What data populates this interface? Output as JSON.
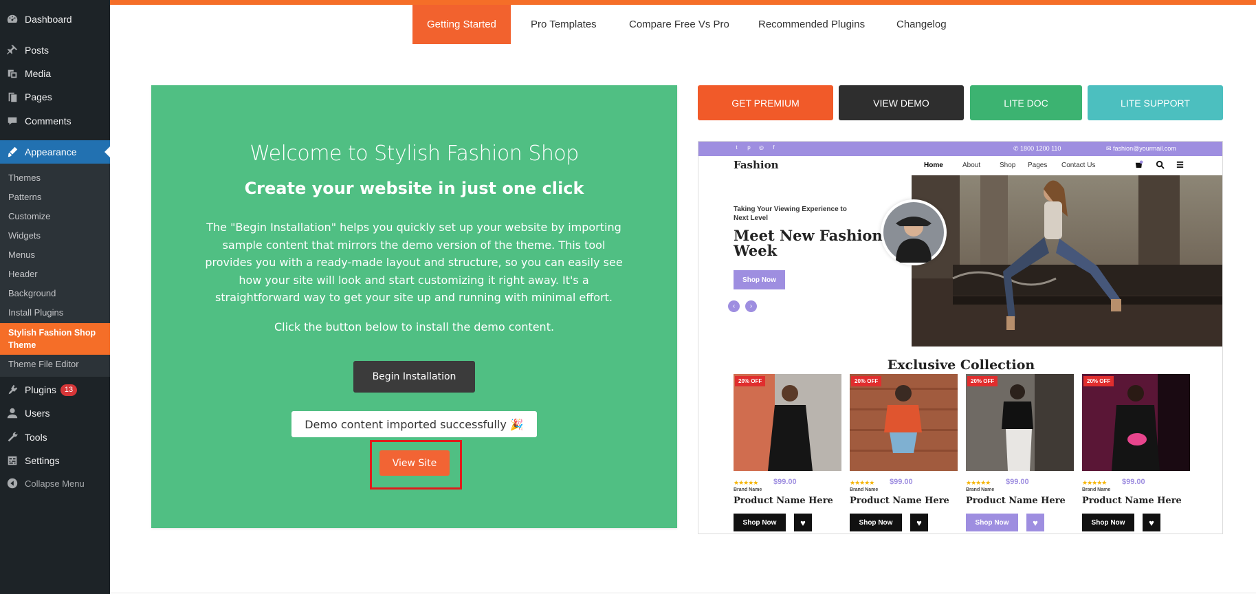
{
  "sidebar": {
    "items": [
      {
        "label": "Dashboard",
        "icon": "dashboard-icon"
      },
      {
        "label": "Posts",
        "icon": "pin-icon"
      },
      {
        "label": "Media",
        "icon": "media-icon"
      },
      {
        "label": "Pages",
        "icon": "pages-icon"
      },
      {
        "label": "Comments",
        "icon": "comment-icon"
      },
      {
        "label": "Appearance",
        "icon": "brush-icon"
      }
    ],
    "appearance_sub": [
      "Themes",
      "Patterns",
      "Customize",
      "Widgets",
      "Menus",
      "Header",
      "Background",
      "Install Plugins"
    ],
    "current_sub": "Stylish Fashion Shop Theme",
    "theme_file_editor": "Theme File Editor",
    "lower_items": [
      {
        "label": "Plugins",
        "icon": "plugin-icon",
        "badge": "13"
      },
      {
        "label": "Users",
        "icon": "users-icon"
      },
      {
        "label": "Tools",
        "icon": "wrench-icon"
      },
      {
        "label": "Settings",
        "icon": "settings-icon"
      }
    ],
    "collapse": "Collapse Menu"
  },
  "tabs": [
    "Getting Started",
    "Pro Templates",
    "Compare Free Vs Pro",
    "Recommended Plugins",
    "Changelog"
  ],
  "welcome": {
    "title": "Welcome to Stylish Fashion Shop",
    "subtitle": "Create your website in just one click",
    "description": "The \"Begin Installation\" helps you quickly set up your website by importing sample content that mirrors the demo version of the theme. This tool provides you with a ready-made layout and structure, so you can easily see how your site will look and start customizing it right away. It's a straightforward way to get your site up and running with minimal effort.",
    "click_text": "Click the button below to install the demo content.",
    "begin_button": "Begin Installation",
    "success_message": "Demo content imported successfully 🎉",
    "view_site_button": "View Site"
  },
  "actions": [
    {
      "label": "GET PREMIUM",
      "color": "#f15a29"
    },
    {
      "label": "VIEW DEMO",
      "color": "#2e2e2e"
    },
    {
      "label": "LITE DOC",
      "color": "#3cb371"
    },
    {
      "label": "LITE SUPPORT",
      "color": "#4cbfbf"
    }
  ],
  "preview": {
    "phone": "1800 1200 110",
    "email": "fashion@yourmail.com",
    "logo": "Fashion",
    "nav": [
      "Home",
      "About",
      "Shop",
      "Pages",
      "Contact Us"
    ],
    "hero_tagline": "Taking Your Viewing Experience to Next Level",
    "hero_title": "Meet New Fashion Week",
    "hero_button": "Shop Now",
    "section_title": "Exclusive Collection",
    "products": [
      {
        "badge": "20% OFF",
        "price": "$99.00",
        "brand": "Brand Name",
        "name": "Product Name Here",
        "button": "Shop Now",
        "highlight": false
      },
      {
        "badge": "20% OFF",
        "price": "$99.00",
        "brand": "Brand Name",
        "name": "Product Name Here",
        "button": "Shop Now",
        "highlight": false
      },
      {
        "badge": "20% OFF",
        "price": "$99.00",
        "brand": "Brand Name",
        "name": "Product Name Here",
        "button": "Shop Now",
        "highlight": true
      },
      {
        "badge": "20% OFF",
        "price": "$99.00",
        "brand": "Brand Name",
        "name": "Product Name Here",
        "button": "Shop Now",
        "highlight": false
      }
    ],
    "accent_color": "#9e8ee0"
  }
}
